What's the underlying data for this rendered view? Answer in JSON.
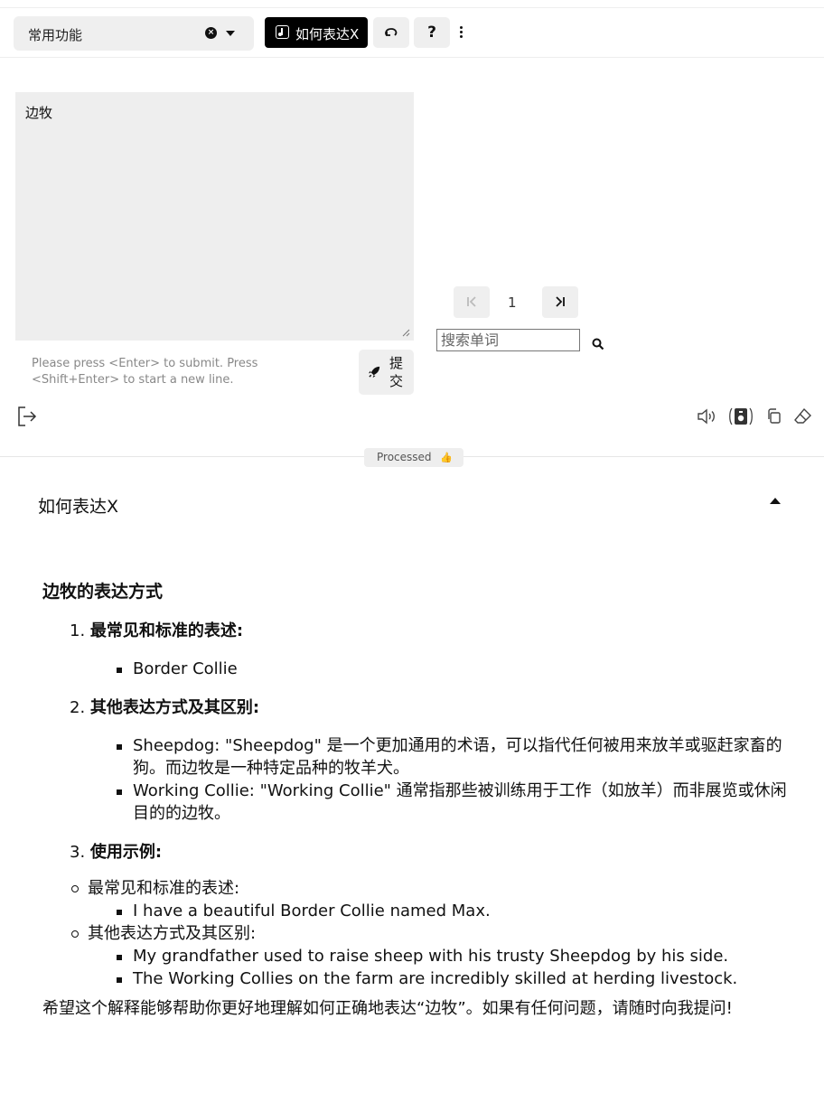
{
  "toolbar": {
    "select_value": "常用功能",
    "mode_button": "如何表达X",
    "help_label": "?"
  },
  "input": {
    "text": "边牧",
    "hint": "Please press <Enter> to submit. Press <Shift+Enter> to start a new line.",
    "submit_label": "提交"
  },
  "pager": {
    "current_page": "1",
    "search_placeholder": "搜索单词"
  },
  "status": {
    "label": "Processed",
    "emoji": "👍"
  },
  "panel": {
    "title": "如何表达X",
    "heading": "边牧的表达方式",
    "sections": [
      {
        "number": "1.",
        "title": "最常见和标准的表述:",
        "items": [
          "Border Collie"
        ]
      },
      {
        "number": "2.",
        "title": "其他表达方式及其区别:",
        "items": [
          "Sheepdog: \"Sheepdog\" 是一个更加通用的术语，可以指代任何被用来放羊或驱赶家畜的狗。而边牧是一种特定品种的牧羊犬。",
          "Working Collie: \"Working Collie\" 通常指那些被训练用于工作（如放羊）而非展览或休闲目的的边牧。"
        ]
      },
      {
        "number": "3.",
        "title": "使用示例:"
      }
    ],
    "examples": [
      {
        "label": "最常见和标准的表述:",
        "items": [
          "I have a beautiful Border Collie named Max."
        ]
      },
      {
        "label": "其他表达方式及其区别:",
        "items": [
          "My grandfather used to raise sheep with his trusty Sheepdog by his side.",
          "The Working Collies on the farm are incredibly skilled at herding livestock."
        ]
      }
    ],
    "closing": "希望这个解释能够帮助你更好地理解如何正确地表达“边牧”。如果有任何问题，请随时向我提问!"
  }
}
